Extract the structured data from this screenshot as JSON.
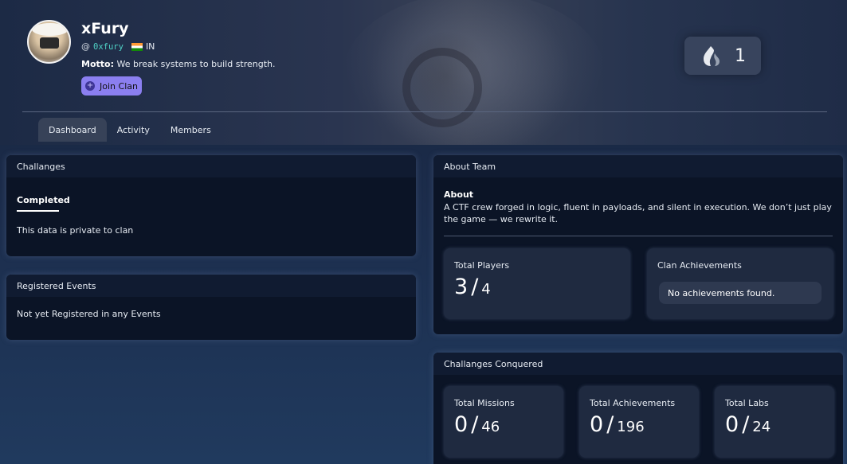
{
  "profile": {
    "name": "xFury",
    "at": "@",
    "handle": "0xfury",
    "country": "IN",
    "motto_label": "Motto:",
    "motto": "We break systems to build strength.",
    "join_label": "Join Clan",
    "streak": "1"
  },
  "tabs": [
    {
      "label": "Dashboard",
      "active": true
    },
    {
      "label": "Activity",
      "active": false
    },
    {
      "label": "Members",
      "active": false
    }
  ],
  "challenges": {
    "title": "Challanges",
    "tab": "Completed",
    "message": "This data is private to clan"
  },
  "events": {
    "title": "Registered Events",
    "message": "Not yet Registered in any Events"
  },
  "about": {
    "title": "About Team",
    "label": "About",
    "text": "A CTF crew forged in logic, fluent in payloads, and silent in execution. We don’t just play the game — we rewrite it.",
    "players_label": "Total Players",
    "players_value": "3",
    "players_total": "4",
    "achievements_label": "Clan Achievements",
    "achievements_empty": "No achievements found."
  },
  "conquered": {
    "title": "Challanges Conquered",
    "stats": [
      {
        "label": "Total Missions",
        "value": "0",
        "total": "46"
      },
      {
        "label": "Total Achievements",
        "value": "0",
        "total": "196"
      },
      {
        "label": "Total Labs",
        "value": "0",
        "total": "24"
      }
    ]
  },
  "colors": {
    "accent": "#8b7ff0",
    "handle": "#4fd1c5",
    "card_bg": "#0b1426"
  }
}
